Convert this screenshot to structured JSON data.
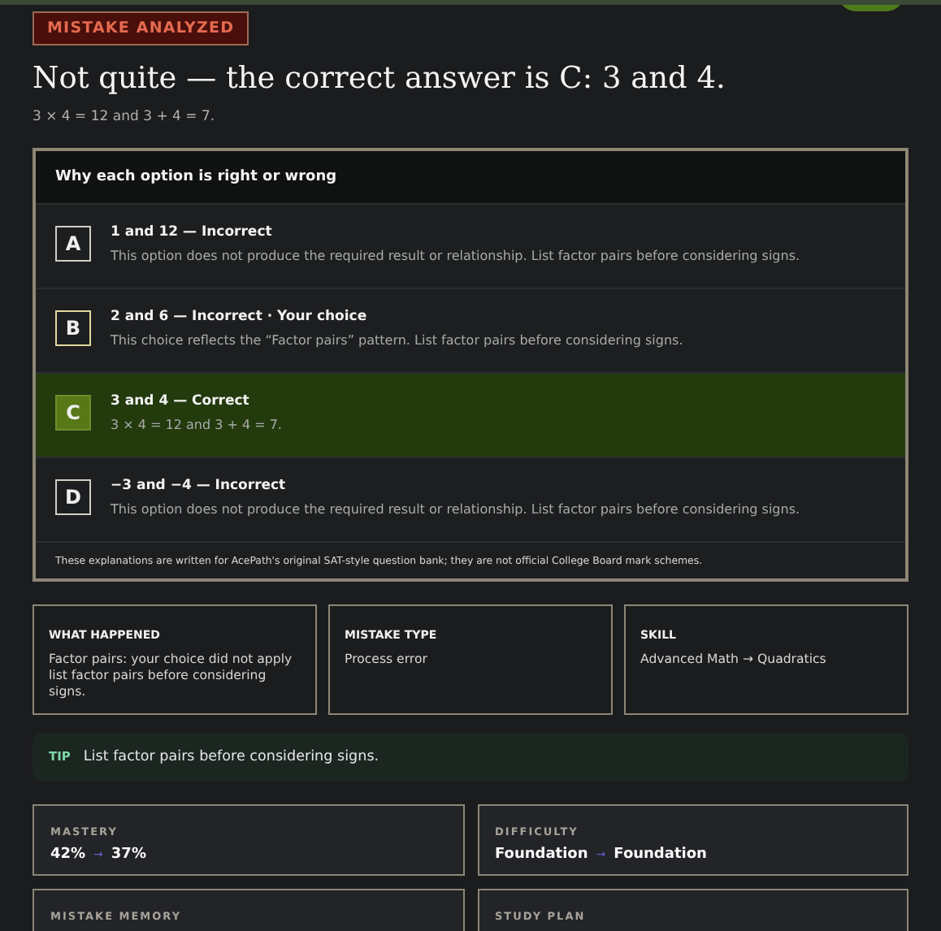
{
  "badge": "MISTAKE ANALYZED",
  "title": "Not quite — the correct answer is C: 3 and 4.",
  "subtitle": "3 × 4 = 12 and 3 + 4 = 7.",
  "explanations": {
    "heading": "Why each option is right or wrong",
    "options": [
      {
        "letter": "A",
        "title": "1 and 12 — Incorrect",
        "text": "This option does not produce the required result or relationship. List factor pairs before considering signs.",
        "correct": false,
        "selected": false
      },
      {
        "letter": "B",
        "title": "2 and 6 — Incorrect · Your choice",
        "text": "This choice reflects the “Factor pairs” pattern. List factor pairs before considering signs.",
        "correct": false,
        "selected": true
      },
      {
        "letter": "C",
        "title": "3 and 4 — Correct",
        "text": "3 × 4 = 12 and 3 + 4 = 7.",
        "correct": true,
        "selected": false
      },
      {
        "letter": "D",
        "title": "−3 and −4 — Incorrect",
        "text": "This option does not produce the required result or relationship. List factor pairs before considering signs.",
        "correct": false,
        "selected": false
      }
    ],
    "footnote": "These explanations are written for AcePath's original SAT-style question bank; they are not official College Board mark schemes."
  },
  "info_cards": [
    {
      "label": "WHAT HAPPENED",
      "text": "Factor pairs: your choice did not apply list factor pairs before considering signs."
    },
    {
      "label": "MISTAKE TYPE",
      "text": "Process error"
    },
    {
      "label": "SKILL",
      "text": "Advanced Math → Quadratics"
    }
  ],
  "tip": {
    "label": "TIP",
    "text": "List factor pairs before considering signs."
  },
  "stat_cards": [
    {
      "label": "MASTERY",
      "from": "42%",
      "arrow": "→",
      "to": "37%"
    },
    {
      "label": "DIFFICULTY",
      "from": "Foundation",
      "arrow": "→",
      "to": "Foundation"
    },
    {
      "label": "MISTAKE MEMORY"
    },
    {
      "label": "STUDY PLAN"
    }
  ]
}
